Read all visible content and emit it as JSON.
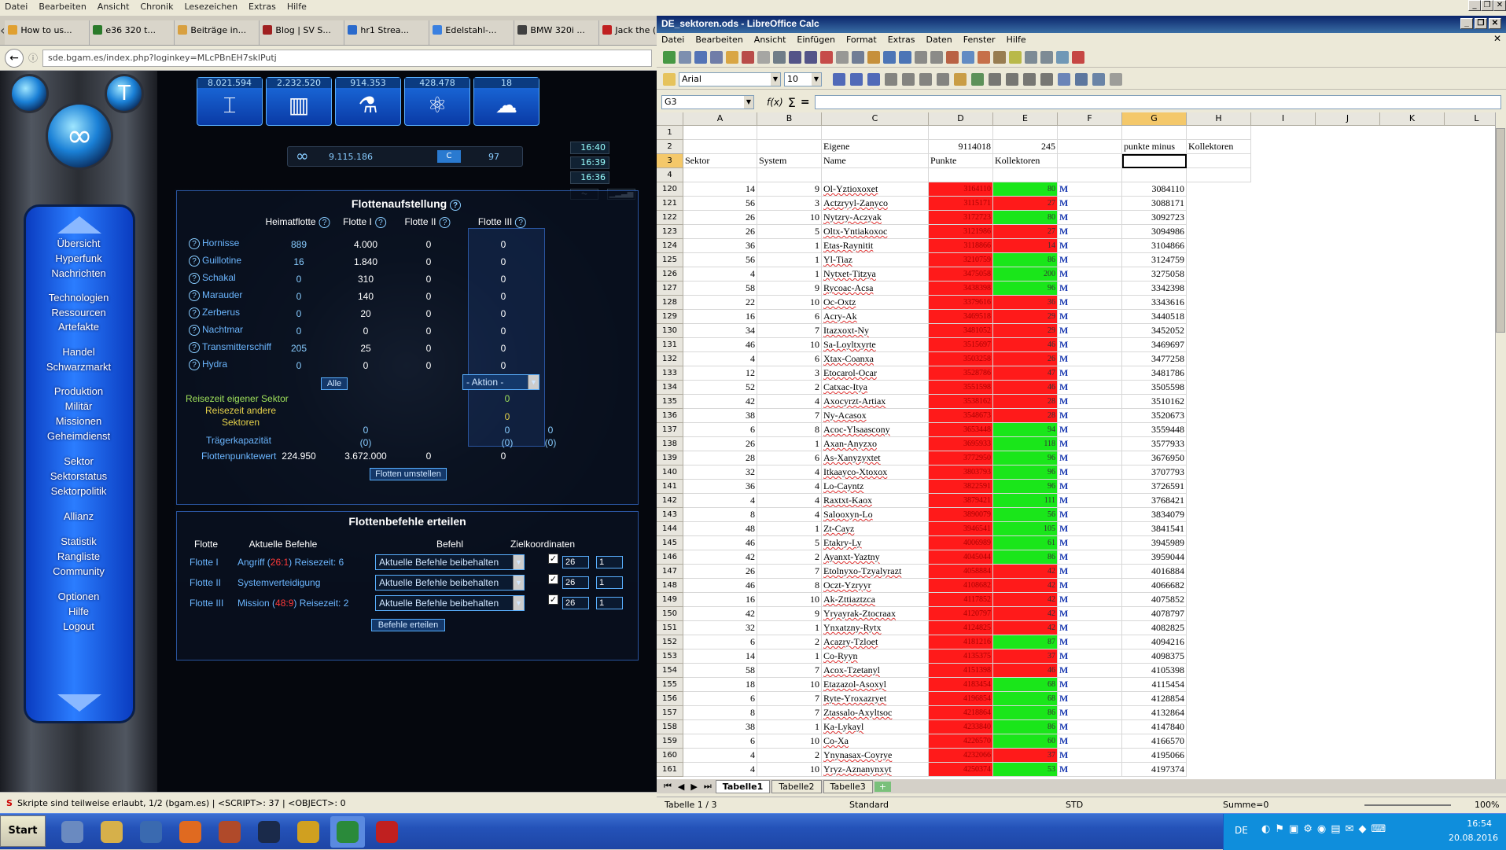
{
  "browser": {
    "menu": [
      "Datei",
      "Bearbeiten",
      "Ansicht",
      "Chronik",
      "Lesezeichen",
      "Extras",
      "Hilfe"
    ],
    "tabs": [
      {
        "label": "How to us...",
        "color": "#e0a030"
      },
      {
        "label": "e36 320 t...",
        "color": "#2a7a2a"
      },
      {
        "label": "Beiträge in...",
        "color": "#d8a040"
      },
      {
        "label": "Blog | SV S...",
        "color": "#a02020"
      },
      {
        "label": "hr1 Strea...",
        "color": "#2a6acc"
      },
      {
        "label": "Edelstahl-...",
        "color": "#3a80e0"
      },
      {
        "label": "BMW 320i ...",
        "color": "#404040"
      },
      {
        "label": "Jack the (...",
        "color": "#c02020"
      }
    ],
    "url": "sde.bgam.es/index.php?loginkey=MLcPBnEH7sklPutj",
    "status": "Skripte sind teilweise erlaubt, 1/2 (bgam.es) | <SCRIPT>: 37 | <OBJECT>: 0"
  },
  "game": {
    "resources": [
      "8.021.594",
      "2.232.520",
      "914.353",
      "428.478",
      "18"
    ],
    "times": [
      "16:40",
      "16:39",
      "16:36"
    ],
    "credits": "9.115.186",
    "c_label": "C",
    "c_value": "97",
    "nav": [
      "Übersicht",
      "Hyperfunk",
      "Nachrichten",
      "Technologien",
      "Ressourcen",
      "Artefakte",
      "Handel",
      "Schwarzmarkt",
      "Produktion",
      "Militär",
      "Missionen",
      "Geheimdienst",
      "Sektor",
      "Sektorstatus",
      "Sektorpolitik",
      "Allianz",
      "Statistik",
      "Rangliste",
      "Community",
      "Optionen",
      "Hilfe",
      "Logout"
    ],
    "fleet": {
      "title": "Flottenaufstellung",
      "headers": [
        "Heimatflotte",
        "Flotte I",
        "Flotte II",
        "Flotte III"
      ],
      "rows": [
        {
          "name": "Hornisse",
          "v": [
            "889",
            "4.000",
            "0",
            "0"
          ]
        },
        {
          "name": "Guillotine",
          "v": [
            "16",
            "1.840",
            "0",
            "0"
          ]
        },
        {
          "name": "Schakal",
          "v": [
            "0",
            "310",
            "0",
            "0"
          ]
        },
        {
          "name": "Marauder",
          "v": [
            "0",
            "140",
            "0",
            "0"
          ]
        },
        {
          "name": "Zerberus",
          "v": [
            "0",
            "20",
            "0",
            "0"
          ]
        },
        {
          "name": "Nachtmar",
          "v": [
            "0",
            "0",
            "0",
            "0"
          ]
        },
        {
          "name": "Transmitterschiff",
          "v": [
            "205",
            "25",
            "0",
            "0"
          ]
        },
        {
          "name": "Hydra",
          "v": [
            "0",
            "0",
            "0",
            "0"
          ]
        }
      ],
      "all_btn": "Alle",
      "action": "- Aktion -",
      "travel_own_label": "Reisezeit eigener Sektor",
      "travel_own_val": "0",
      "travel_other_label": "Reisezeit andere Sektoren",
      "travel_other_val": "0",
      "carrier_label": "Trägerkapazität",
      "carrier_vals": [
        "0",
        "(0)",
        "0",
        "(0)",
        "0",
        "(0)"
      ],
      "points_label": "Flottenpunktewert",
      "points": [
        "224.950",
        "3.672.000",
        "0",
        "0"
      ],
      "rearrange_btn": "Flotten umstellen"
    },
    "orders": {
      "title": "Flottenbefehle erteilen",
      "headers": [
        "Flotte",
        "Aktuelle Befehle",
        "Befehl",
        "Zielkoordinaten"
      ],
      "rows": [
        {
          "fleet": "Flotte I",
          "pre": "Angriff (",
          "coord": "26:1",
          "post": ") Reisezeit: 6",
          "cmd": "Aktuelle Befehle beibehalten",
          "x": "26",
          "y": "1"
        },
        {
          "fleet": "Flotte II",
          "pre": "Systemverteidigung",
          "coord": "",
          "post": "",
          "cmd": "Aktuelle Befehle beibehalten",
          "x": "26",
          "y": "1"
        },
        {
          "fleet": "Flotte III",
          "pre": "Mission (",
          "coord": "48:9",
          "post": ") Reisezeit: 2",
          "cmd": "Aktuelle Befehle beibehalten",
          "x": "26",
          "y": "1"
        }
      ],
      "submit": "Befehle erteilen"
    }
  },
  "calc": {
    "title": "DE_sektoren.ods - LibreOffice Calc",
    "menu": [
      "Datei",
      "Bearbeiten",
      "Ansicht",
      "Einfügen",
      "Format",
      "Extras",
      "Daten",
      "Fenster",
      "Hilfe"
    ],
    "font": "Arial",
    "size": "10",
    "cellref": "G3",
    "cols": [
      "A",
      "B",
      "C",
      "D",
      "E",
      "F",
      "G",
      "H",
      "I",
      "J",
      "K",
      "L"
    ],
    "header_rows": [
      {
        "n": "1",
        "cells": [
          "",
          "",
          "",
          "",
          "",
          "",
          "",
          ""
        ]
      },
      {
        "n": "2",
        "cells": [
          "",
          "",
          "Eigene",
          "9114018",
          "245",
          "",
          "punkte minus",
          "Kollektoren"
        ]
      },
      {
        "n": "3",
        "cells": [
          "Sektor",
          "System",
          "Name",
          "Punkte",
          "Kollektoren",
          "",
          "",
          ""
        ]
      },
      {
        "n": "4",
        "cells": [
          "",
          "",
          "",
          "",
          "",
          "",
          "",
          ""
        ]
      }
    ],
    "rows": [
      [
        "120",
        "14",
        "9",
        "Ol-Yztioxoxet",
        "3164110",
        "80",
        "g",
        "M",
        "3084110"
      ],
      [
        "121",
        "56",
        "3",
        "Actzryyl-Zanyco",
        "3115171",
        "27",
        "r",
        "M",
        "3088171"
      ],
      [
        "122",
        "26",
        "10",
        "Nytzry-Aczyak",
        "3172723",
        "80",
        "g",
        "M",
        "3092723"
      ],
      [
        "123",
        "26",
        "5",
        "Oltx-Yntiakoxoc",
        "3121986",
        "27",
        "r",
        "M",
        "3094986"
      ],
      [
        "124",
        "36",
        "1",
        "Etas-Raynitit",
        "3118866",
        "14",
        "r",
        "M",
        "3104866"
      ],
      [
        "125",
        "56",
        "1",
        "Yl-Tiaz",
        "3210759",
        "86",
        "g",
        "M",
        "3124759"
      ],
      [
        "126",
        "4",
        "1",
        "Nytxet-Titzya",
        "3475058",
        "200",
        "g",
        "M",
        "3275058"
      ],
      [
        "127",
        "58",
        "9",
        "Rycoac-Acsa",
        "3438398",
        "96",
        "g",
        "M",
        "3342398"
      ],
      [
        "128",
        "22",
        "10",
        "Oc-Oxtz",
        "3379616",
        "36",
        "r",
        "M",
        "3343616"
      ],
      [
        "129",
        "16",
        "6",
        "Acry-Ak",
        "3469518",
        "29",
        "r",
        "M",
        "3440518"
      ],
      [
        "130",
        "34",
        "7",
        "Itazxoxt-Ny",
        "3481052",
        "29",
        "r",
        "M",
        "3452052"
      ],
      [
        "131",
        "46",
        "10",
        "Sa-Loyltxyrte",
        "3515697",
        "46",
        "r",
        "M",
        "3469697"
      ],
      [
        "132",
        "4",
        "6",
        "Xtax-Coanxa",
        "3503258",
        "26",
        "r",
        "M",
        "3477258"
      ],
      [
        "133",
        "12",
        "3",
        "Etocarol-Ocar",
        "3528786",
        "47",
        "r",
        "M",
        "3481786"
      ],
      [
        "134",
        "52",
        "2",
        "Catxac-Itya",
        "3551598",
        "46",
        "r",
        "M",
        "3505598"
      ],
      [
        "135",
        "42",
        "4",
        "Axocyrzt-Artiax",
        "3538162",
        "28",
        "r",
        "M",
        "3510162"
      ],
      [
        "136",
        "38",
        "7",
        "Ny-Acasox",
        "3548673",
        "28",
        "r",
        "M",
        "3520673"
      ],
      [
        "137",
        "6",
        "8",
        "Acoc-Ylsaascony",
        "3653448",
        "94",
        "g",
        "M",
        "3559448"
      ],
      [
        "138",
        "26",
        "1",
        "Axan-Anyzxo",
        "3695933",
        "118",
        "g",
        "M",
        "3577933"
      ],
      [
        "139",
        "28",
        "6",
        "As-Xanyzyxtet",
        "3772950",
        "96",
        "g",
        "M",
        "3676950"
      ],
      [
        "140",
        "32",
        "4",
        "Itkaayco-Xtoxox",
        "3803793",
        "96",
        "g",
        "M",
        "3707793"
      ],
      [
        "141",
        "36",
        "4",
        "Lo-Cayntz",
        "3822591",
        "96",
        "g",
        "M",
        "3726591"
      ],
      [
        "142",
        "4",
        "4",
        "Raxtxt-Kaox",
        "3879421",
        "111",
        "g",
        "M",
        "3768421"
      ],
      [
        "143",
        "8",
        "4",
        "Salooxyn-Lo",
        "3890079",
        "56",
        "g",
        "M",
        "3834079"
      ],
      [
        "144",
        "48",
        "1",
        "Zt-Cayz",
        "3946541",
        "105",
        "g",
        "M",
        "3841541"
      ],
      [
        "145",
        "46",
        "5",
        "Etakry-Ly",
        "4006989",
        "61",
        "g",
        "M",
        "3945989"
      ],
      [
        "146",
        "42",
        "2",
        "Ayanxt-Yaztny",
        "4045044",
        "86",
        "g",
        "M",
        "3959044"
      ],
      [
        "147",
        "26",
        "7",
        "Etolnyxo-Tzyalyrazt",
        "4058884",
        "42",
        "r",
        "M",
        "4016884"
      ],
      [
        "148",
        "46",
        "8",
        "Oczt-Yzryyr",
        "4108682",
        "42",
        "r",
        "M",
        "4066682"
      ],
      [
        "149",
        "16",
        "10",
        "Ak-Zttiaztzca",
        "4117852",
        "42",
        "r",
        "M",
        "4075852"
      ],
      [
        "150",
        "42",
        "9",
        "Yryayrak-Ztocraax",
        "4120797",
        "42",
        "r",
        "M",
        "4078797"
      ],
      [
        "151",
        "32",
        "1",
        "Ynxatzny-Rytx",
        "4124825",
        "42",
        "r",
        "M",
        "4082825"
      ],
      [
        "152",
        "6",
        "2",
        "Acazry-Tzloet",
        "4181216",
        "87",
        "g",
        "M",
        "4094216"
      ],
      [
        "153",
        "14",
        "1",
        "Co-Ryyn",
        "4135375",
        "37",
        "r",
        "M",
        "4098375"
      ],
      [
        "154",
        "58",
        "7",
        "Acox-Tzetanyl",
        "4151398",
        "46",
        "r",
        "M",
        "4105398"
      ],
      [
        "155",
        "18",
        "10",
        "Etazazol-Asoxyl",
        "4183454",
        "68",
        "g",
        "M",
        "4115454"
      ],
      [
        "156",
        "6",
        "7",
        "Ryte-Yroxazryet",
        "4196854",
        "68",
        "g",
        "M",
        "4128854"
      ],
      [
        "157",
        "8",
        "7",
        "Ztassalo-Axyltsoc",
        "4218864",
        "86",
        "g",
        "M",
        "4132864"
      ],
      [
        "158",
        "38",
        "1",
        "Ka-Lykayl",
        "4233840",
        "86",
        "g",
        "M",
        "4147840"
      ],
      [
        "159",
        "6",
        "10",
        "Co-Xa",
        "4226570",
        "60",
        "g",
        "M",
        "4166570"
      ],
      [
        "160",
        "4",
        "2",
        "Ynynasax-Coyrye",
        "4232066",
        "37",
        "r",
        "M",
        "4195066"
      ],
      [
        "161",
        "4",
        "10",
        "Yryz-Aznanynxyt",
        "4250374",
        "53",
        "g",
        "M",
        "4197374"
      ]
    ],
    "sheettabs": [
      "Tabelle1",
      "Tabelle2",
      "Tabelle3"
    ],
    "status": {
      "sheet": "Tabelle 1 / 3",
      "style": "Standard",
      "mode": "STD",
      "sum": "Summe=0",
      "zoom": "100%"
    },
    "colors": {
      "red": "#ff1a1a",
      "green": "#1ae61a",
      "sel": "#000"
    }
  },
  "taskbar": {
    "start": "Start",
    "lang": "DE",
    "time": "16:54",
    "date": "20.08.2016"
  }
}
